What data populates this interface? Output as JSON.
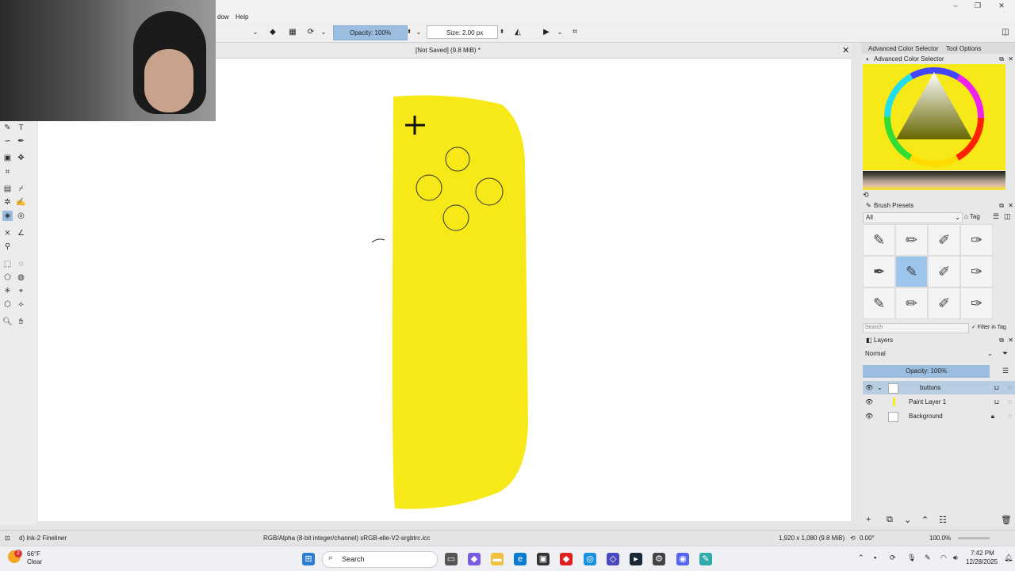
{
  "menu": {
    "window": "dow",
    "help": "Help"
  },
  "toolbar": {
    "opacity": "Opacity: 100%",
    "size": "Size: 2.00 px"
  },
  "document": {
    "title": "[Not Saved]  (9.8 MiB) *"
  },
  "dock": {
    "tabs": [
      "Advanced Color Selector",
      "Tool Options"
    ],
    "color_panel_title": "Advanced Color Selector",
    "brush_panel_title": "Brush Presets",
    "brush_filter": "All",
    "brush_tag": "Tag",
    "brush_search_placeholder": "Search",
    "filter_in_tag": "Filter in Tag",
    "layers_title": "Layers",
    "blend_mode": "Normal",
    "layer_opacity": "Opacity:  100%",
    "layers": [
      {
        "name": "buttons",
        "selected": true
      },
      {
        "name": "Paint Layer 1",
        "selected": false
      },
      {
        "name": "Background",
        "selected": false
      }
    ]
  },
  "status": {
    "brush": "d) Ink-2 Fineliner",
    "color_profile": "RGB/Alpha (8-bit integer/channel)  sRGB-elle-V2-srgbtrc.icc",
    "dimensions": "1,920 x 1,080 (9.8 MiB)",
    "rotation": "0.00°",
    "zoom": "100.0%"
  },
  "taskbar": {
    "weather_temp": "66°F",
    "weather_desc": "Clear",
    "weather_badge": "2",
    "search": "Search",
    "time": "7:42 PM",
    "date": "12/28/2025"
  },
  "colors": {
    "accent": "#9bbde0",
    "fill_yellow": "#f7e817",
    "layer_selected": "#b8cde2"
  }
}
